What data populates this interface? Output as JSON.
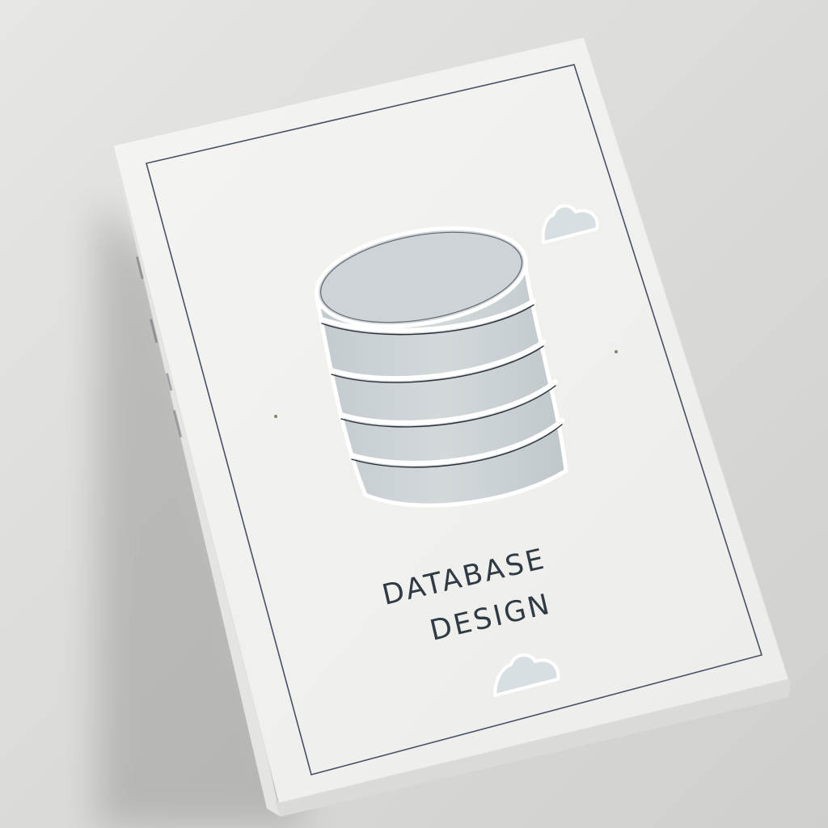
{
  "book": {
    "title_line_1": "DATABASE",
    "title_line_2": "DESIGN"
  },
  "colors": {
    "background": "#dcdcda",
    "cover": "#f2f2ef",
    "spine": "#e9e9e5",
    "cylinder_fill": "#ccd3d6",
    "border_line": "#4a4f66",
    "title_text": "#2f3a44"
  },
  "icons": [
    "database-icon",
    "cloud-icon"
  ]
}
